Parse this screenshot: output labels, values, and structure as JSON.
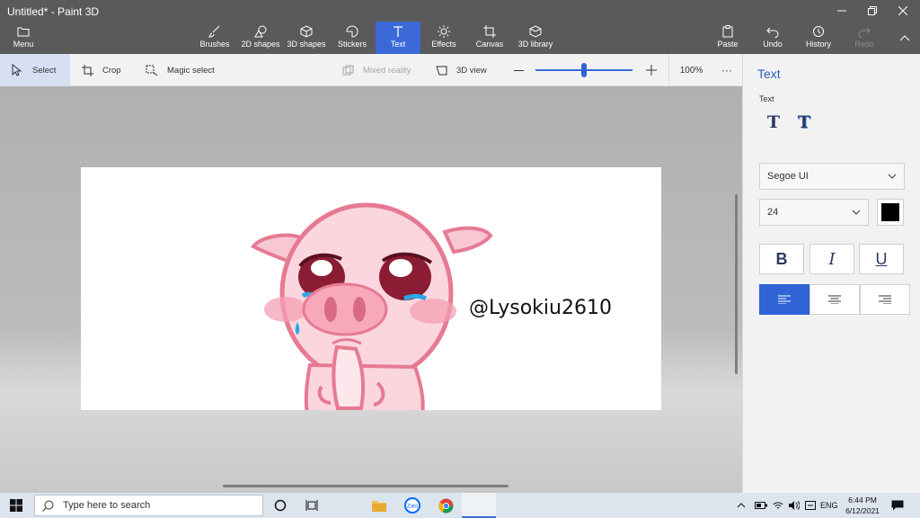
{
  "window": {
    "title": "Untitled* - Paint 3D"
  },
  "ribbon": {
    "menu": "Menu",
    "tools": [
      {
        "id": "brushes",
        "label": "Brushes"
      },
      {
        "id": "2d-shapes",
        "label": "2D shapes"
      },
      {
        "id": "3d-shapes",
        "label": "3D shapes"
      },
      {
        "id": "stickers",
        "label": "Stickers"
      },
      {
        "id": "text",
        "label": "Text",
        "active": true
      },
      {
        "id": "effects",
        "label": "Effects"
      },
      {
        "id": "canvas",
        "label": "Canvas"
      },
      {
        "id": "3d-library",
        "label": "3D library"
      }
    ],
    "right": [
      {
        "id": "paste",
        "label": "Paste"
      },
      {
        "id": "undo",
        "label": "Undo"
      },
      {
        "id": "history",
        "label": "History"
      },
      {
        "id": "redo",
        "label": "Redo",
        "disabled": true
      }
    ]
  },
  "subbar": {
    "select": "Select",
    "crop": "Crop",
    "magic_select": "Magic select",
    "mixed_reality": "Mixed reality",
    "view_3d": "3D view",
    "zoom_percent": "100%",
    "zoom_level": 0.5
  },
  "canvas": {
    "text": "@Lysokiu2610"
  },
  "panel": {
    "title": "Text",
    "section_label": "Text",
    "font": "Segoe UI",
    "size": "24",
    "color": "#000000",
    "bold_label": "B",
    "italic_label": "I",
    "underline_label": "U"
  },
  "taskbar": {
    "search_placeholder": "Type here to search",
    "language": "ENG",
    "time": "6:44 PM",
    "date": "6/12/2021"
  },
  "colors": {
    "accent": "#2f63d6",
    "titlebar": "#5a5a5a"
  }
}
